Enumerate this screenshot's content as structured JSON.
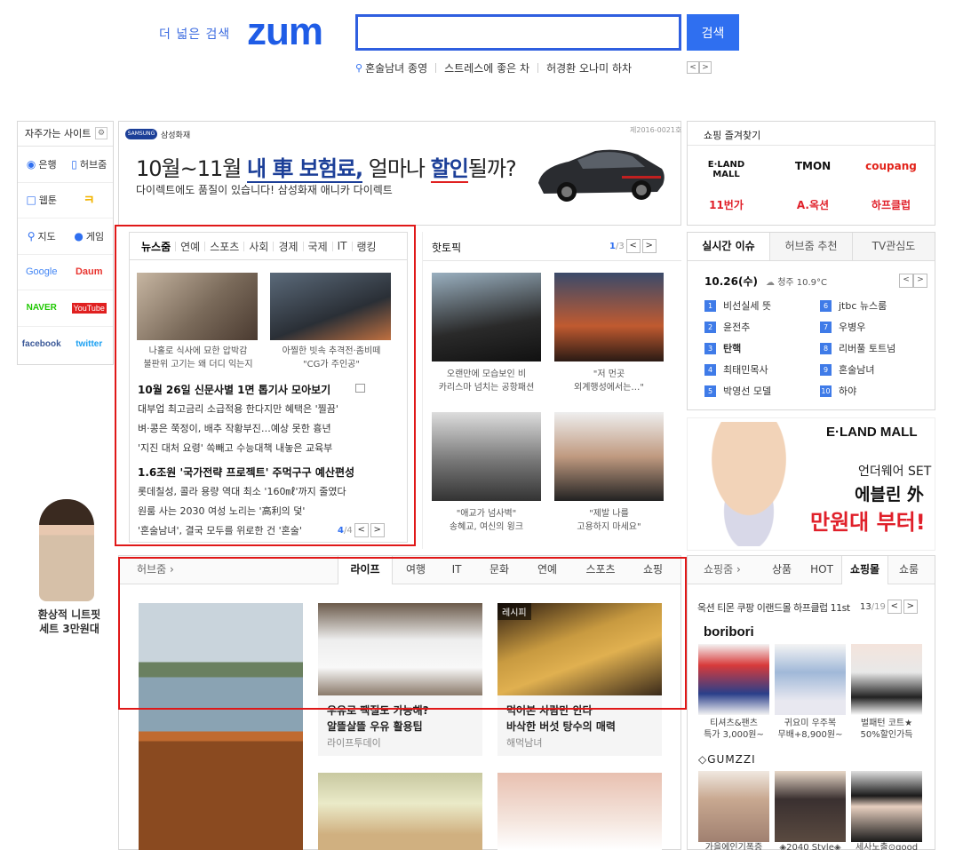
{
  "header": {
    "tagline": "더 넓은 검색",
    "logo": "zum",
    "search_placeholder": "",
    "search_button": "검색",
    "trending": [
      "혼술남녀 종영",
      "스트레스에 좋은 차",
      "허경환 오나미 하차"
    ]
  },
  "sites": {
    "title": "자주가는 사이트",
    "rows": [
      [
        "은행",
        "허브줌"
      ],
      [
        "웹툰",
        "ㅋ"
      ],
      [
        "지도",
        "게임"
      ],
      [
        "Google",
        "Daum"
      ],
      [
        "NAVER",
        "YouTube"
      ],
      [
        "facebook",
        "twitter"
      ]
    ]
  },
  "left_ad": {
    "text": "환상적 니트핏\n세트 3만원대"
  },
  "samsung_banner": {
    "logo": "SAMSUNG",
    "brand": "삼성화재",
    "code": "제2016-0021호",
    "headline_pre": "10월~11월 ",
    "headline_bold": "내 車 보험료,",
    "headline_mid": " 얼마나 ",
    "headline_bold2": "할인",
    "headline_post": "될까?",
    "sub": "다이렉트에도 품질이 있습니다! 삼성화재 애니카 다이렉트"
  },
  "news": {
    "tabs": [
      "뉴스줌",
      "연예",
      "스포츠",
      "사회",
      "경제",
      "국제",
      "IT",
      "랭킹"
    ],
    "photos": [
      {
        "caption": "나홀로 식사에 묘한 압박감\n불판위 고기는 왜 더디 익는지"
      },
      {
        "caption": "아찔한 빗속 추격전·좀비떼\n\"CG가 주인공\""
      }
    ],
    "headline1": "10월 26일 신문사별 1면 톱기사 모아보기",
    "items1": [
      "대부업 최고금리 소급적용 한다지만 혜택은 '찔끔'",
      "벼·콩은 쭉정이, 배추 작황부진…예상 못한 흉년",
      "'지진 대처 요령' 쏙빼고 수능대책 내놓은 교육부"
    ],
    "headline2": "1.6조원 '국가전략 프로젝트' 주먹구구 예산편성",
    "items2": [
      "롯데칠성, 콜라 용량 역대 최소 '160㎖'까지 줄였다",
      "원룸 사는 2030 여성 노리는 '高利의 덫'",
      "'혼술남녀', 결국 모두를 위로한 건 '혼술'"
    ],
    "page": "4",
    "total": "/4"
  },
  "hot_topic": {
    "title": "핫토픽",
    "page": "1",
    "total": "/3",
    "items": [
      {
        "caption": "오랜만에 모습보인 비\n카리스마 넘치는 공항패션"
      },
      {
        "caption": "\"저 먼곳\n외계행성에서는…\""
      },
      {
        "caption": "\"애교가 넘사벽\"\n송혜교, 여신의 윙크"
      },
      {
        "caption": "\"제발 나를\n고용하지 마세요\""
      }
    ]
  },
  "shop_fav": {
    "title": "쇼핑 즐겨찾기",
    "logos": [
      "E·LAND MALL",
      "TMON",
      "coupang",
      "11번가",
      "A.옥션",
      "하프클럽"
    ]
  },
  "realtime": {
    "tabs": [
      "실시간 이슈",
      "허브줌 추천",
      "TV관심도"
    ],
    "date": "10.26(수)",
    "weather": "청주 10.9°C",
    "ranks": [
      {
        "n": "1",
        "t": "비선실세 뜻"
      },
      {
        "n": "2",
        "t": "윤전추"
      },
      {
        "n": "3",
        "t": "탄핵"
      },
      {
        "n": "4",
        "t": "최태민목사"
      },
      {
        "n": "5",
        "t": "박영선 모델"
      },
      {
        "n": "6",
        "t": "jtbc 뉴스룸"
      },
      {
        "n": "7",
        "t": "우병우"
      },
      {
        "n": "8",
        "t": "리버풀 토트넘"
      },
      {
        "n": "9",
        "t": "혼술남녀"
      },
      {
        "n": "10",
        "t": "하야"
      }
    ]
  },
  "eland_ad": {
    "brand": "E·LAND MALL",
    "line1": "언더웨어 SET",
    "line2": "에블린 外",
    "line3": "만원대 부터!"
  },
  "hubzum": {
    "title": "허브줌",
    "tabs": [
      "라이프",
      "여행",
      "IT",
      "문화",
      "연예",
      "스포츠",
      "쇼핑"
    ],
    "cards": [
      {
        "badge": "",
        "title": "",
        "source": ""
      },
      {
        "badge": "",
        "title": "우유로 팩질도 가능해?\n알뜰살뜰 우유 활용팁",
        "source": "라이프투데이"
      },
      {
        "badge": "레시피",
        "title": "먹어본 사람만 안다\n바삭한 버섯 탕수의 매력",
        "source": "해먹남녀"
      }
    ]
  },
  "shopzum": {
    "title": "쇼핑줌",
    "tabs": [
      "상품",
      "HOT",
      "쇼핑몰",
      "쇼룸"
    ],
    "malls": "옥션 티몬 쿠팡 이랜드몰 하프클럽 11st",
    "page": "13",
    "total": "/19",
    "brand1": "boribori",
    "brand2": "GUMZZI",
    "products": [
      {
        "caption": "티셔츠&팬츠\n특가 3,000원~"
      },
      {
        "caption": "귀요미 우주복\n무배+8,900원~"
      },
      {
        "caption": "벌패턴 코트★\n50%할인가득"
      }
    ],
    "products2": [
      {
        "caption": "가을에인기폭증"
      },
      {
        "caption": "◈2040 Style◈"
      },
      {
        "caption": "세사노출⊙good"
      }
    ]
  }
}
